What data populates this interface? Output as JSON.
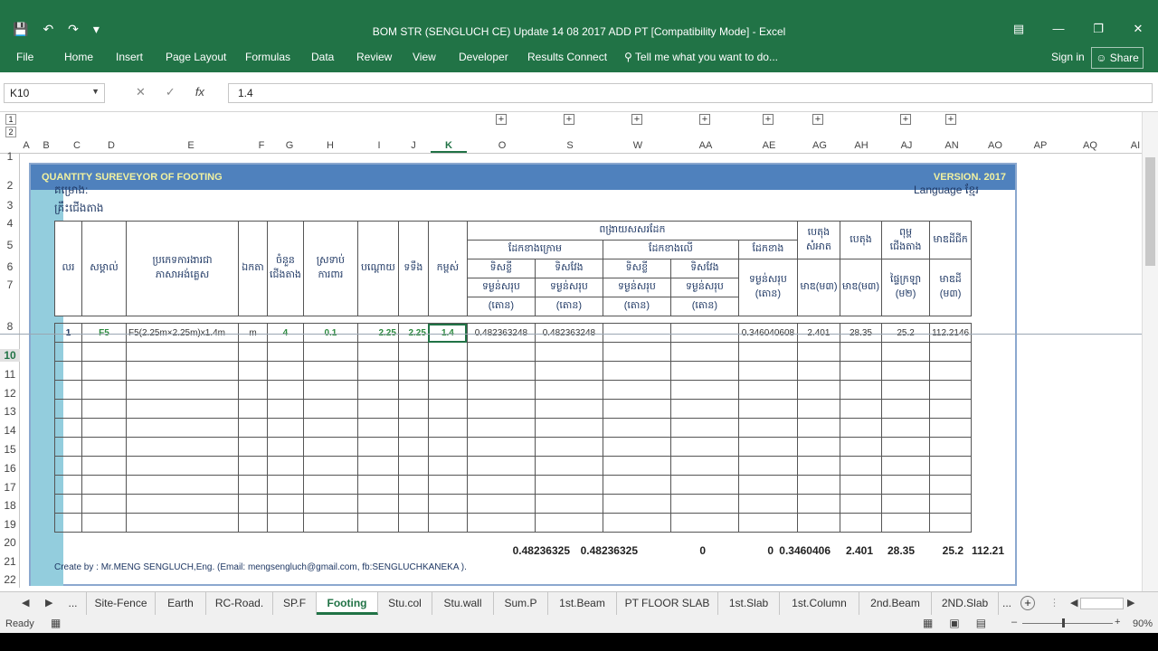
{
  "window": {
    "title": "BOM STR (SENGLUCH CE) Update  14 08 2017 ADD PT  [Compatibility Mode] - Excel",
    "qat": [
      "save-icon",
      "undo-icon",
      "redo-icon",
      "customize-icon"
    ]
  },
  "ribbon": {
    "tabs": [
      "File",
      "Home",
      "Insert",
      "Page Layout",
      "Formulas",
      "Data",
      "Review",
      "View",
      "Developer",
      "Results Connect"
    ],
    "tell": "Tell me what you want to do...",
    "signin": "Sign in",
    "share": "Share"
  },
  "formula_bar": {
    "name_box": "K10",
    "value": "1.4"
  },
  "outline_levels": [
    "1",
    "2"
  ],
  "columns": [
    "A",
    "B",
    "C",
    "D",
    "E",
    "F",
    "G",
    "H",
    "I",
    "J",
    "K",
    "O",
    "S",
    "W",
    "AA",
    "AE",
    "AG",
    "AH",
    "AJ",
    "AN",
    "AO",
    "AP",
    "AQ",
    "AI"
  ],
  "rows": [
    "1",
    "2",
    "3",
    "4",
    "5",
    "6",
    "7",
    "8",
    "10",
    "11",
    "12",
    "13",
    "14",
    "15",
    "16",
    "17",
    "18",
    "19",
    "20",
    "21",
    "22"
  ],
  "sheet": {
    "banner_left": "QUANTITY SUREVEYOR OF FOOTING",
    "banner_right": "VERSION. 2017",
    "project_label": "គម្រោង:",
    "subject_label": "គ្រឹះជើងតាង",
    "language": "Language",
    "language_value": "ខ្មែរ",
    "headers": {
      "no": "លរ",
      "mark": "សម្គាល់",
      "desc": "ប្រភេទការងារជាភាសាអង់គ្លេស",
      "unit": "ឯកតា",
      "count": "ចំនួនជើងតាង",
      "thick": "ស្រទាប់ការពារ",
      "length": "បណ្តោយ",
      "width": "ទទឹង",
      "height": "កម្ពស់",
      "rebar_group": "ពង្រាយសសរដែក",
      "bottom": "ដែកខាងក្រោម",
      "top": "ដែកខាងលើ",
      "side": "ដែកខាង",
      "dir1": "ទិសខ្លី",
      "dir2": "ទិសវែង",
      "weight": "ទម្ងន់សរុប",
      "ton": "(តោន)",
      "concrete": "បេតុងសំអាត",
      "concrete2": "បេតុង",
      "m3": "មាឌ(ម៣)",
      "formwork": "ពុម្ពជើងតាង",
      "formwork_sub": "ផ្ទៃក្រឡា",
      "m2": "(ម២)",
      "soil": "មាឌដីជីក",
      "soil_sub": "មាឌដី",
      "m3b": "(ម៣)"
    },
    "data_row": {
      "no": "1",
      "mark": "F5",
      "desc": "F5(2.25m×2.25m)x1.4m",
      "unit": "m",
      "count": "4",
      "thick": "0.1",
      "length": "2.25",
      "width": "2.25",
      "height": "1.4",
      "b_short": "0.482363248",
      "b_long": "0.482363248",
      "t_short": "",
      "t_long": "",
      "side": "0.346040608",
      "concrete": "2.401",
      "concrete2": "28.35",
      "formwork": "25.2",
      "soil": "112.2146"
    },
    "totals": {
      "b_short": "0.48236325",
      "b_long": "0.48236325",
      "t_short": "0",
      "t_long": "0",
      "side": "0.3460406",
      "concrete": "2.401",
      "concrete2": "28.35",
      "formwork": "25.2",
      "soil": "112.21"
    },
    "credit": "Create by : Mr.MENG SENGLUCH,Eng. (Email: mengsengluch@gmail.com, fb:SENGLUCHKANEKA )."
  },
  "sheet_tabs": [
    "...",
    "Site-Fence",
    "Earth",
    "RC-Road.",
    "SP.F",
    "Footing",
    "Stu.col",
    "Stu.wall",
    "Sum.P",
    "1st.Beam",
    "PT FLOOR SLAB",
    "1st.Slab",
    "1st.Column",
    "2nd.Beam",
    "2ND.Slab",
    "..."
  ],
  "active_sheet": "Footing",
  "status": {
    "ready": "Ready",
    "zoom": "90%"
  }
}
